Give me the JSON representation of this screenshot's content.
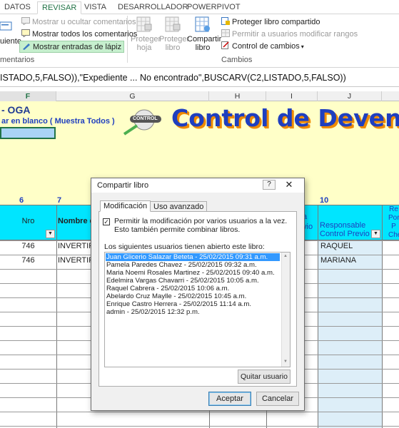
{
  "ribbon": {
    "tabs": [
      "DATOS",
      "REVISAR",
      "VISTA",
      "DESARROLLADOR",
      "POWERPIVOT"
    ],
    "active_tab": "REVISAR",
    "comments": {
      "show_hide": "Mostrar u ocultar comentarios",
      "show_all": "Mostrar todos los comentarios",
      "show_ink": "Mostrar entradas de lápiz",
      "partial_next": "uiente",
      "group_label": "mentarios"
    },
    "changes": {
      "protect_sheet_1": "Proteger",
      "protect_sheet_2": "hoja",
      "protect_book_1": "Proteger",
      "protect_book_2": "libro",
      "share_book_1": "Compartir",
      "share_book_2": "libro",
      "protect_share": "Proteger libro compartido",
      "allow_ranges": "Permitir a usuarios modificar rangos",
      "track_changes": "Control de cambios",
      "group_label": "Cambios"
    }
  },
  "formula_bar": {
    "text": "ISTADO,5,FALSO)),\"Expediente ... No encontrado\",BUSCARV(C2,LISTADO,5,FALSO))"
  },
  "columns": [
    "F",
    "G",
    "H",
    "I",
    "J"
  ],
  "sheet": {
    "title_partial": "- OGA",
    "link_text": "ar en blanco ( Muestra Todos )",
    "banner_title": "Control de Devengad",
    "logo_text": "CONTROL",
    "header_row_numbers": [
      "6",
      "7",
      "10"
    ],
    "col_nro": "Nro",
    "col_nombre": "Nombre de",
    "col_partial_i_1": "a",
    "col_partial_i_2": "vio",
    "col_responsable_1": "Responsable",
    "col_responsable_2": "Control Previo",
    "col_partial_k": [
      "Re",
      "Por",
      "P",
      "Che"
    ],
    "rows": [
      {
        "nro": "746",
        "nombre": "INVERTIR",
        "responsable": "RAQUEL"
      },
      {
        "nro": "746",
        "nombre": "INVERTIR",
        "responsable": "MARIANA"
      }
    ]
  },
  "dialog": {
    "title": "Compartir libro",
    "help": "?",
    "tabs": [
      "Modificación",
      "Uso avanzado"
    ],
    "checkbox_label": "Permitir la modificación por varios usuarios a la vez. Esto también permite combinar libros.",
    "checkbox_checked": true,
    "users_label": "Los siguientes usuarios tienen abierto este libro:",
    "users": [
      "Juan Glicerio Salazar Beteta - 25/02/2015 09:31 a.m.",
      "Pamela Paredes Chavez - 25/02/2015 09:32 a.m.",
      "Maria Noemi Rosales Martinez - 25/02/2015 09:40 a.m.",
      "Edelmira Vargas Chavarri - 25/02/2015 10:05 a.m.",
      "Raquel Cabrera - 25/02/2015 10:06 a.m.",
      "Abelardo Cruz Maylle - 25/02/2015 10:45 a.m.",
      "Enrique Castro Herrera - 25/02/2015 11:14 a.m.",
      "admin - 25/02/2015 12:32 p.m."
    ],
    "selected_user_index": 0,
    "remove_user": "Quitar usuario",
    "ok": "Aceptar",
    "cancel": "Cancelar"
  },
  "colors": {
    "accent": "#217346",
    "sheet_yellow": "#ffffc8",
    "header_cyan": "#00e5ff",
    "banner_blue": "#1f3fbf",
    "banner_orange": "#f08a00",
    "selection_blue": "#3399ff"
  },
  "icons": [
    "comment-icon",
    "comments-icon",
    "pen-icon",
    "protect-sheet-icon",
    "protect-book-icon",
    "share-book-icon",
    "protect-share-icon",
    "allow-ranges-icon",
    "track-changes-icon",
    "control-logo-icon",
    "help-icon",
    "close-icon",
    "filter-dropdown-icon"
  ]
}
